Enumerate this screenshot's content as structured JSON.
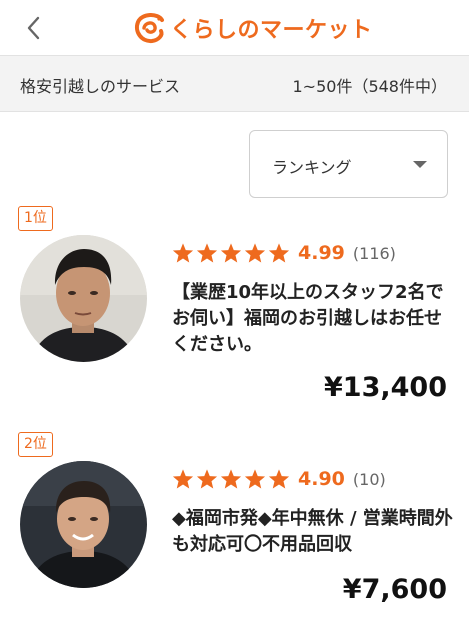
{
  "header": {
    "back_icon": "chevron-left-icon",
    "logo_text": "くらしのマーケット",
    "brand_color": "#ee6a1e"
  },
  "subbar": {
    "title": "格安引越しのサービス",
    "count": "1~50件（548件中）"
  },
  "sort": {
    "selected": "ランキング",
    "icon": "caret-down-icon"
  },
  "listings": [
    {
      "rank": "1位",
      "stars": 5,
      "score": "4.99",
      "reviews": "(116)",
      "title": "【業歴10年以上のスタッフ2名でお伺い】福岡のお引越しはお任せください。",
      "price": "¥13,400"
    },
    {
      "rank": "2位",
      "stars": 5,
      "score": "4.90",
      "reviews": "(10)",
      "title": "◆福岡市発◆年中無休 / 営業時間外も対応可〇不用品回収",
      "price": "¥7,600"
    }
  ]
}
